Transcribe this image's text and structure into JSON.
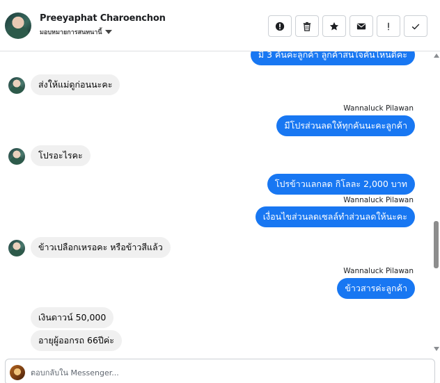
{
  "header": {
    "name": "Preeyaphat Charoenchon",
    "subtitle": "มอบหมายการสนทนานี้",
    "actions": [
      {
        "name": "report-icon"
      },
      {
        "name": "trash-icon"
      },
      {
        "name": "star-icon"
      },
      {
        "name": "mail-icon"
      },
      {
        "name": "exclamation-icon"
      },
      {
        "name": "check-icon"
      }
    ]
  },
  "messages": {
    "m0": "มี 3 คันค่ะลูกค้า  ลูกค้าสนใจคันไหนดีคะ",
    "m1": "ส่งให้แม่ดูก่อนนะคะ",
    "s1": "Wannaluck Pilawan",
    "m2": "มีโปรส่วนลดให้ทุกคันนะคะลูกค้า",
    "m3": "โปรอะไรคะ",
    "m4": "โปรข้าวแลกลด กิโลละ 2,000 บาท",
    "s2": "Wannaluck Pilawan",
    "m5": "เงื่อนไขส่วนลดเซลล์ทำส่วนลดให้นะคะ",
    "m6": "ข้าวเปลือกเหรอคะ หรือข้าวสีแล้ว",
    "s3": "Wannaluck Pilawan",
    "m7": "ข้าวสารค่ะลูกค้า",
    "m8": "เงินดาวน์ 50,000",
    "m9": "อายุผู้ออกรถ 66ปีค่ะ"
  },
  "composer": {
    "placeholder": "ตอบกลับใน Messenger..."
  },
  "colors": {
    "outgoing": "#1877f2",
    "incoming": "#f0f0f0"
  }
}
